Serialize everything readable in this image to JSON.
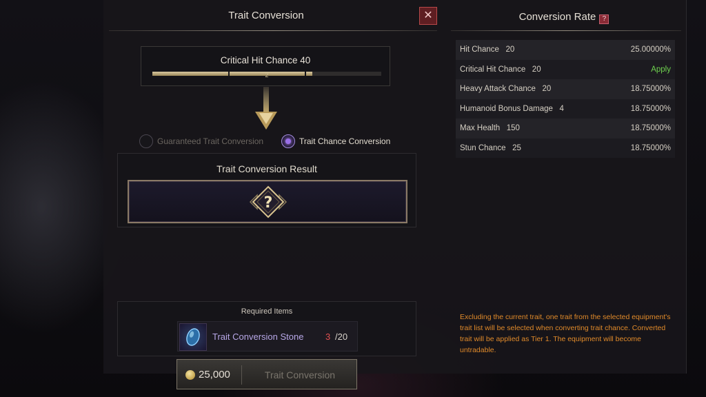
{
  "left": {
    "title": "Trait Conversion",
    "trait_label": "Critical Hit Chance 40",
    "trait_bar": {
      "segments": 3,
      "filled_segments": 2,
      "fill": 0.7,
      "marker": "2"
    },
    "options": [
      {
        "label": "Guaranteed Trait Conversion",
        "selected": false
      },
      {
        "label": "Trait Chance Conversion",
        "selected": true
      }
    ],
    "result_title": "Trait Conversion Result",
    "result_icon": "question-mark-icon",
    "required_title": "Required Items",
    "required_item": {
      "name": "Trait Conversion Stone",
      "have": "3",
      "need": "/20",
      "icon": "gem-icon"
    },
    "cost": "25,000",
    "convert_label": "Trait Conversion"
  },
  "right": {
    "title": "Conversion Rate",
    "help_icon": "?",
    "rates": [
      {
        "name": "Hit Chance   20",
        "value": "25.00000%",
        "apply": false
      },
      {
        "name": "Critical Hit Chance   20",
        "value": "Apply",
        "apply": true
      },
      {
        "name": "Heavy Attack Chance   20",
        "value": "18.75000%",
        "apply": false
      },
      {
        "name": "Humanoid Bonus Damage   4",
        "value": "18.75000%",
        "apply": false
      },
      {
        "name": "Max Health   150",
        "value": "18.75000%",
        "apply": false
      },
      {
        "name": "Stun Chance   25",
        "value": "18.75000%",
        "apply": false
      }
    ],
    "note": "Excluding the current trait, one trait from the selected equipment's trait list will be selected when converting trait chance. Converted trait will be applied as Tier 1. The equipment will become untradable."
  },
  "colors": {
    "accent": "#9a6fe8",
    "apply": "#6fd24f",
    "warning": "#e08a2a",
    "short": "#e05050"
  },
  "close_icon": "✕"
}
